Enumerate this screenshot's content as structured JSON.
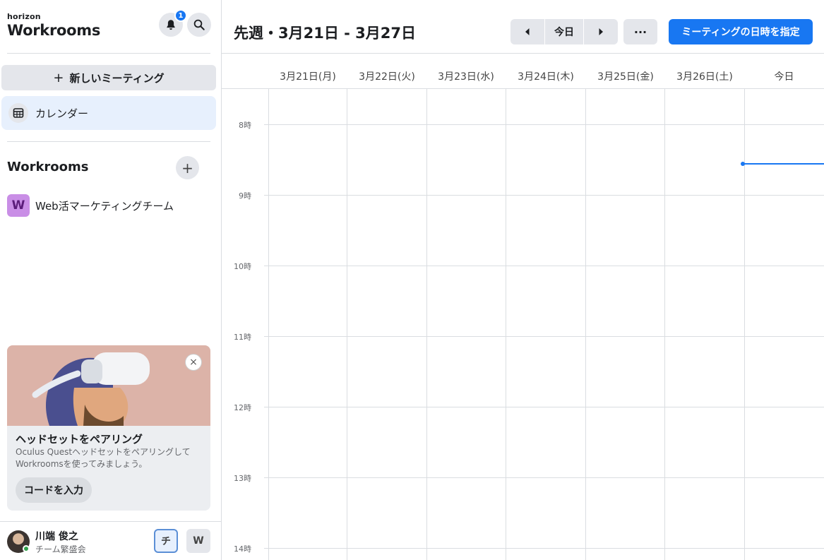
{
  "brand": {
    "small": "horizon",
    "big": "Workrooms"
  },
  "notifications": {
    "count": "1"
  },
  "sidebar": {
    "new_meeting_label": "新しいミーティング",
    "nav_calendar": "カレンダー",
    "section_title": "Workrooms",
    "rooms": [
      {
        "initial": "W",
        "name": "Web活マーケティングチーム"
      }
    ]
  },
  "promo": {
    "title": "ヘッドセットをペアリング",
    "description": "Oculus Questヘッドセットをペアリングして\nWorkroomsを使ってみましょう。",
    "button": "コードを入力",
    "close": "×"
  },
  "user": {
    "name": "川端 俊之",
    "team": "チーム繁盛会",
    "workspaces": [
      "チ",
      "W"
    ]
  },
  "header": {
    "week_title": "先週・3月21日 - 3月27日",
    "today_label": "今日",
    "more_label": "···",
    "schedule_label": "ミーティングの日時を指定"
  },
  "days": [
    "3月21日(月)",
    "3月22日(火)",
    "3月23日(水)",
    "3月24日(木)",
    "3月25日(金)",
    "3月26日(土)",
    "今日"
  ],
  "hours": [
    "8時",
    "9時",
    "10時",
    "11時",
    "12時",
    "13時",
    "14時"
  ],
  "colors": {
    "accent": "#1877f2",
    "room_avatar": "#c98ee6",
    "online": "#31a24c"
  }
}
